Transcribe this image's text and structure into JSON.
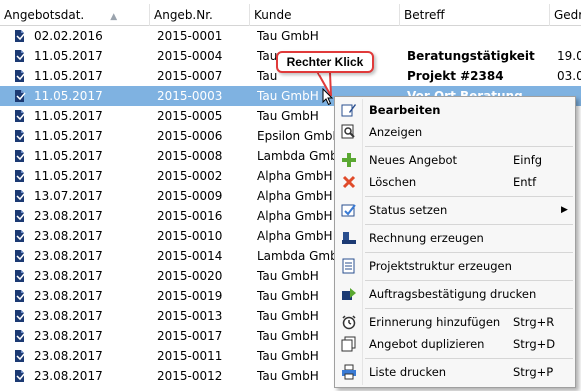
{
  "columns": [
    "Angebotsdat.",
    "Angeb.Nr.",
    "Kunde",
    "Betreff",
    "Gedr"
  ],
  "rows": [
    {
      "date": "02.02.2016",
      "nr": "2015-0001",
      "kunde": "Tau GmbH",
      "betreff": "",
      "extra": ""
    },
    {
      "date": "11.05.2017",
      "nr": "2015-0004",
      "kunde": "Tau ",
      "betreff": "Beratungstätigkeit",
      "extra": "19.0"
    },
    {
      "date": "11.05.2017",
      "nr": "2015-0007",
      "kunde": "Tau ",
      "betreff": "Projekt #2384",
      "extra": "03.0"
    },
    {
      "date": "11.05.2017",
      "nr": "2015-0003",
      "kunde": "Tau GmbH",
      "betreff": "Vor Ort Beratung",
      "extra": ""
    },
    {
      "date": "11.05.2017",
      "nr": "2015-0005",
      "kunde": "Tau GmbH",
      "betreff": "",
      "extra": ""
    },
    {
      "date": "11.05.2017",
      "nr": "2015-0006",
      "kunde": "Epsilon GmbH",
      "betreff": "",
      "extra": ""
    },
    {
      "date": "11.05.2017",
      "nr": "2015-0008",
      "kunde": "Lambda GmbH",
      "betreff": "",
      "extra": ""
    },
    {
      "date": "11.05.2017",
      "nr": "2015-0002",
      "kunde": "Alpha GmbH",
      "betreff": "",
      "extra": ""
    },
    {
      "date": "13.07.2017",
      "nr": "2015-0009",
      "kunde": "Alpha GmbH",
      "betreff": "",
      "extra": ""
    },
    {
      "date": "23.08.2017",
      "nr": "2015-0016",
      "kunde": "Alpha GmbH",
      "betreff": "",
      "extra": ""
    },
    {
      "date": "23.08.2017",
      "nr": "2015-0010",
      "kunde": "Alpha GmbH",
      "betreff": "",
      "extra": ""
    },
    {
      "date": "23.08.2017",
      "nr": "2015-0014",
      "kunde": "Lambda GmbH",
      "betreff": "",
      "extra": ""
    },
    {
      "date": "23.08.2017",
      "nr": "2015-0020",
      "kunde": "Tau GmbH",
      "betreff": "",
      "extra": ""
    },
    {
      "date": "23.08.2017",
      "nr": "2015-0019",
      "kunde": "Tau GmbH",
      "betreff": "",
      "extra": ""
    },
    {
      "date": "23.08.2017",
      "nr": "2015-0013",
      "kunde": "Tau GmbH",
      "betreff": "",
      "extra": ""
    },
    {
      "date": "23.08.2017",
      "nr": "2015-0017",
      "kunde": "Tau GmbH",
      "betreff": "",
      "extra": ""
    },
    {
      "date": "23.08.2017",
      "nr": "2015-0011",
      "kunde": "Tau GmbH",
      "betreff": "",
      "extra": ""
    },
    {
      "date": "23.08.2017",
      "nr": "2015-0012",
      "kunde": "Tau GmbH",
      "betreff": "",
      "extra": ""
    }
  ],
  "selected_row": 3,
  "tooltip": "Rechter Klick",
  "menu": [
    {
      "label": "Bearbeiten",
      "shortcut": "",
      "icon": "edit-icon",
      "bold": true
    },
    {
      "label": "Anzeigen",
      "shortcut": "",
      "icon": "view-icon"
    },
    {
      "sep": true
    },
    {
      "label": "Neues Angebot",
      "shortcut": "Einfg",
      "icon": "plus-icon"
    },
    {
      "label": "Löschen",
      "shortcut": "Entf",
      "icon": "delete-icon"
    },
    {
      "sep": true
    },
    {
      "label": "Status setzen",
      "shortcut": "",
      "icon": "status-icon",
      "submenu": true
    },
    {
      "sep": true
    },
    {
      "label": "Rechnung erzeugen",
      "shortcut": "",
      "icon": "invoice-icon"
    },
    {
      "sep": true
    },
    {
      "label": "Projektstruktur erzeugen",
      "shortcut": "",
      "icon": "project-icon"
    },
    {
      "sep": true
    },
    {
      "label": "Auftragsbestätigung drucken",
      "shortcut": "",
      "icon": "order-confirm-icon"
    },
    {
      "sep": true
    },
    {
      "label": "Erinnerung hinzufügen",
      "shortcut": "Strg+R",
      "icon": "alarm-icon"
    },
    {
      "label": "Angebot duplizieren",
      "shortcut": "Strg+D",
      "icon": "duplicate-icon"
    },
    {
      "sep": true
    },
    {
      "label": "Liste drucken",
      "shortcut": "Strg+P",
      "icon": "printer-icon"
    }
  ],
  "colors": {
    "selection": "#7fb2e1",
    "tooltip_border": "#e03a3a",
    "menu_bg": "#f7f7f7"
  }
}
